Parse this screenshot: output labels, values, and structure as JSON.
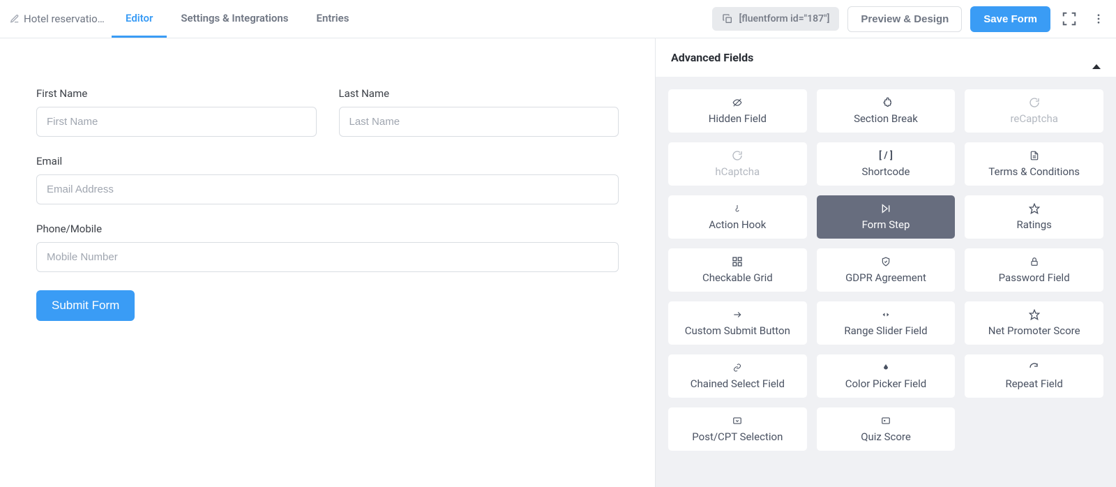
{
  "header": {
    "form_name": "Hotel reservatio…",
    "tabs": {
      "editor": "Editor",
      "settings": "Settings & Integrations",
      "entries": "Entries"
    },
    "shortcode": "[fluentform id=\"187\"]",
    "preview_btn": "Preview & Design",
    "save_btn": "Save Form"
  },
  "form": {
    "first_name": {
      "label": "First Name",
      "placeholder": "First Name"
    },
    "last_name": {
      "label": "Last Name",
      "placeholder": "Last Name"
    },
    "email": {
      "label": "Email",
      "placeholder": "Email Address"
    },
    "phone": {
      "label": "Phone/Mobile",
      "placeholder": "Mobile Number"
    },
    "submit": "Submit Form"
  },
  "sidebar": {
    "panel_title": "Advanced Fields",
    "fields": {
      "hidden": "Hidden Field",
      "section_break": "Section Break",
      "recaptcha": "reCaptcha",
      "hcaptcha": "hCaptcha",
      "shortcode": "Shortcode",
      "terms": "Terms & Conditions",
      "action_hook": "Action Hook",
      "form_step": "Form Step",
      "ratings": "Ratings",
      "checkable_grid": "Checkable Grid",
      "gdpr": "GDPR Agreement",
      "password": "Password Field",
      "custom_submit": "Custom Submit Button",
      "range_slider": "Range Slider Field",
      "nps": "Net Promoter Score",
      "chained_select": "Chained Select Field",
      "color_picker": "Color Picker Field",
      "repeat": "Repeat Field",
      "post_cpt": "Post/CPT Selection",
      "quiz": "Quiz Score"
    }
  }
}
